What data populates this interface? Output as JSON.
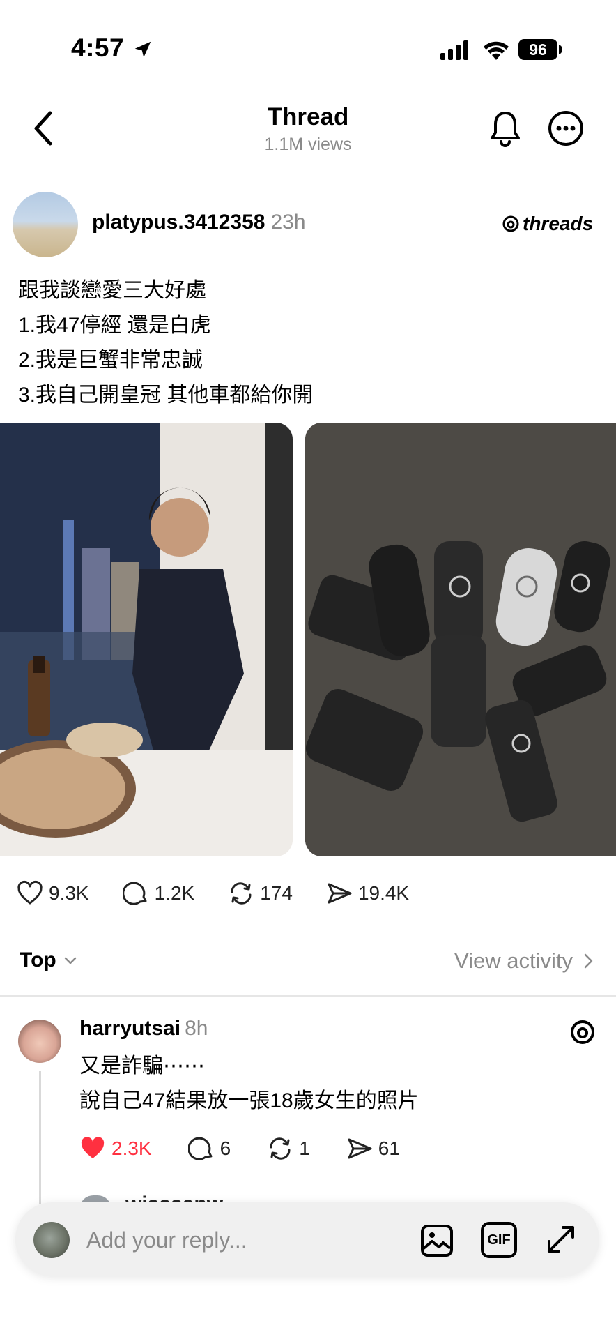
{
  "status_bar": {
    "time": "4:57",
    "battery": "96"
  },
  "header": {
    "title": "Thread",
    "views": "1.1M views"
  },
  "post": {
    "username": "platypus.3412358",
    "time_ago": "23h",
    "brand": "threads",
    "lines": [
      "跟我談戀愛三大好處",
      "1.我47停經 還是白虎",
      "2.我是巨蟹非常忠誠",
      "3.我自己開皇冠 其他車都給你開"
    ],
    "likes": "9.3K",
    "comments": "1.2K",
    "reposts": "174",
    "shares": "19.4K"
  },
  "sort": {
    "label": "Top",
    "view_activity": "View activity"
  },
  "comment": {
    "username": "harryutsai",
    "time_ago": "8h",
    "lines": [
      "又是詐騙⋯⋯",
      "說自己47結果放一張18歲女生的照片"
    ],
    "likes": "2.3K",
    "replies": "6",
    "reposts": "1",
    "shares": "61",
    "like_color": "#ff3040"
  },
  "next_comment": {
    "username": "wisssanw"
  },
  "reply": {
    "placeholder": "Add your reply...",
    "gif_label": "GIF"
  }
}
